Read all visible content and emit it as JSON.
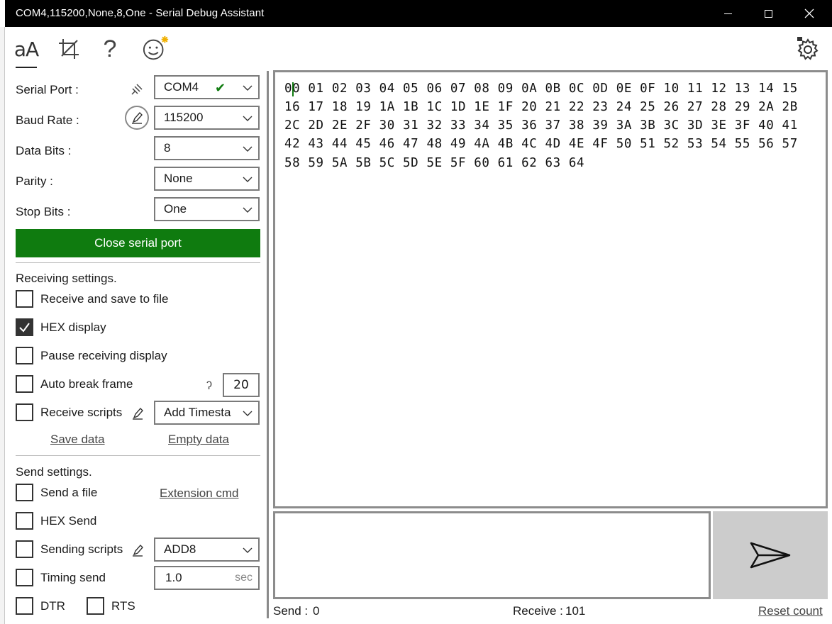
{
  "window": {
    "title": "COM4,115200,None,8,One - Serial Debug Assistant"
  },
  "toolbar": {
    "font_icon": "aA",
    "help_icon": "?"
  },
  "serial": {
    "port_label": "Serial Port :",
    "port_value": "COM4",
    "baud_label": "Baud Rate :",
    "baud_value": "115200",
    "databits_label": "Data Bits :",
    "databits_value": "8",
    "parity_label": "Parity :",
    "parity_value": "None",
    "stopbits_label": "Stop Bits :",
    "stopbits_value": "One",
    "toggle_button": "Close serial port"
  },
  "receiving": {
    "title": "Receiving settings.",
    "save_to_file": "Receive and save to file",
    "hex_display": "HEX display",
    "pause_display": "Pause receiving display",
    "auto_break": "Auto break frame",
    "auto_break_value": "20",
    "scripts": "Receive scripts",
    "scripts_value": "Add Timesta",
    "save_data": "Save data",
    "empty_data": "Empty data"
  },
  "sending": {
    "title": "Send settings.",
    "send_file": "Send a file",
    "extension_cmd": "Extension cmd",
    "hex_send": "HEX Send",
    "scripts": "Sending scripts",
    "scripts_value": "ADD8",
    "timing_send": "Timing send",
    "timing_value": "1.0",
    "timing_unit": "sec",
    "dtr": "DTR",
    "rts": "RTS"
  },
  "receive_lines": [
    "00 01 02 03 04 05 06 07 08 09 0A 0B 0C 0D 0E 0F 10 11 12 13 14 15",
    "16 17 18 19 1A 1B 1C 1D 1E 1F 20 21 22 23 24 25 26 27 28 29 2A 2B",
    "2C 2D 2E 2F 30 31 32 33 34 35 36 37 38 39 3A 3B 3C 3D 3E 3F 40 41",
    "42 43 44 45 46 47 48 49 4A 4B 4C 4D 4E 4F 50 51 52 53 54 55 56 57",
    "58 59 5A 5B 5C 5D 5E 5F 60 61 62 63 64"
  ],
  "status": {
    "send_label": "Send :",
    "send_count": "0",
    "receive_label": "Receive :",
    "receive_count": "101",
    "reset": "Reset count"
  },
  "colors": {
    "accent_green": "#0f7b0f",
    "titlebar": "#000000",
    "send_button": "#cccccc"
  }
}
